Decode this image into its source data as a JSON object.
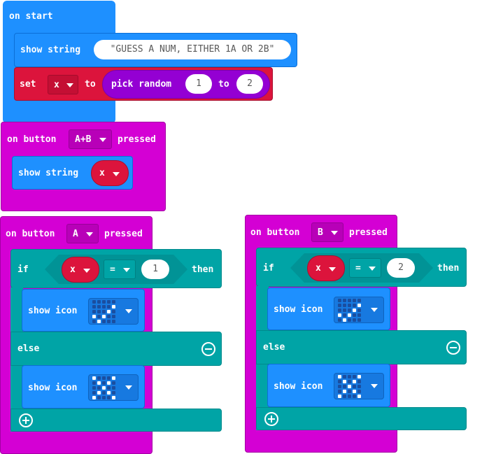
{
  "on_start": {
    "label": "on start",
    "show_string_label": "show string",
    "show_string_value": "\"GUESS A NUM, EITHER 1A OR 2B\"",
    "set_label": "set",
    "var_name": "x",
    "to_label": "to",
    "pick_random_label": "pick random",
    "random_min": "1",
    "random_to_label": "to",
    "random_max": "2"
  },
  "on_button_ab": {
    "on_label": "on button",
    "button": "A+B",
    "pressed_label": "pressed",
    "show_string_label": "show string",
    "var_name": "x"
  },
  "on_button_a": {
    "on_label": "on button",
    "button": "A",
    "pressed_label": "pressed",
    "if_label": "if",
    "var_name": "x",
    "op": "=",
    "compare_value": "1",
    "then_label": "then",
    "show_icon_label": "show icon",
    "else_label": "else",
    "show_icon_label_2": "show icon",
    "icon_then": "yes-check-icon",
    "icon_else": "no-cross-icon"
  },
  "on_button_b": {
    "on_label": "on button",
    "button": "B",
    "pressed_label": "pressed",
    "if_label": "if",
    "var_name": "x",
    "op": "=",
    "compare_value": "2",
    "then_label": "then",
    "show_icon_label": "show icon",
    "else_label": "else",
    "show_icon_label_2": "show icon",
    "icon_then": "yes-check-icon",
    "icon_else": "no-cross-icon"
  },
  "colors": {
    "basic": "#1e90ff",
    "variables": "#dc143c",
    "math": "#9400d3",
    "input": "#d400d4",
    "logic": "#00a4a6"
  }
}
